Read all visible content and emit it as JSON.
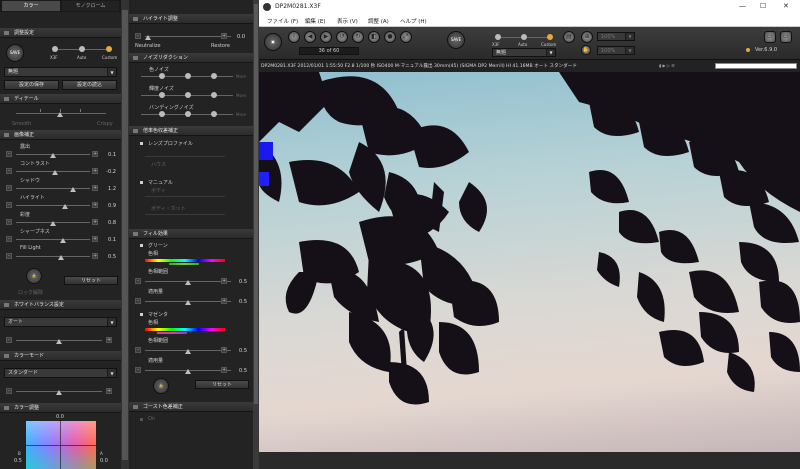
{
  "left_panel": {
    "tabs": [
      "カラー",
      "モノクローム"
    ],
    "adjust_section": {
      "title": "調整設定",
      "mode_labels": [
        "X3F",
        "Auto",
        "Custom"
      ],
      "preset_value": "無題",
      "save_button": "設定の保存",
      "load_button": "設定の読込"
    },
    "detail_section": {
      "title": "ディテール",
      "left_label": "Smooth",
      "right_label": "Crispy"
    },
    "image_section": {
      "title": "画像補正",
      "rows": [
        {
          "label": "露出",
          "value": "0.1"
        },
        {
          "label": "コントラスト",
          "value": "-0.2"
        },
        {
          "label": "シャドウ",
          "value": "1.2"
        },
        {
          "label": "ハイライト",
          "value": "0.9"
        },
        {
          "label": "彩度",
          "value": "0.8"
        },
        {
          "label": "シャープネス",
          "value": "0.1"
        },
        {
          "label": "Fill Light",
          "value": "0.5"
        }
      ],
      "reset_button": "リセット",
      "lock_label": "ロック解除"
    },
    "wb_section": {
      "title": "ホワイトバランス設定",
      "value": "オート"
    },
    "color_mode_section": {
      "title": "カラーモード",
      "value": "スタンダード"
    },
    "color_adjust_section": {
      "title": "カラー調整",
      "top_value": "0.0",
      "left_value": "0.5",
      "right_label": "A",
      "right_value": "0.0",
      "left_label": "B"
    }
  },
  "middle_panel": {
    "highlight_section": {
      "title": "ハイライト調整",
      "value": "0.0",
      "left_label": "Neutralize",
      "right_label": "Restore"
    },
    "noise_section": {
      "title": "ノイズリダクション",
      "rows": [
        "色ノイズ",
        "輝度ノイズ",
        "バンディングノイズ"
      ],
      "end_label": "More"
    },
    "lens_section": {
      "title": "倍率色収差補正",
      "profile_check": "レンズプロファイル",
      "manual_check": "マニュアル",
      "dim_labels": [
        "ハウス",
        "ボディ",
        "ボディ・カット"
      ]
    },
    "fill_section": {
      "title": "フィル効果",
      "blocks": [
        {
          "check": "グリーン",
          "sub": "色相",
          "range_label": "色相範囲",
          "amount_label": "適用量",
          "values": [
            "0.5",
            "0.5"
          ]
        },
        {
          "check": "マゼンタ",
          "sub": "色相",
          "range_label": "色相範囲",
          "amount_label": "適用量",
          "values": [
            "0.5",
            "0.5"
          ]
        }
      ],
      "reset_button": "リセット"
    },
    "ghost_section": {
      "title": "ゴースト色差補正",
      "check": "On"
    }
  },
  "window": {
    "title": "DP2M0281.X3F",
    "menu": [
      "ファイル (F)",
      "編集 (E)",
      "表示 (V)",
      "調整 (A)",
      "ヘルプ (H)"
    ],
    "controls": [
      "—",
      "☐",
      "✕"
    ]
  },
  "toolbar": {
    "counter": "36 of 60",
    "mode_labels": [
      "X3F",
      "Auto",
      "Custom"
    ],
    "preset_value": "無題",
    "zoom_values": [
      "100%",
      "100%"
    ],
    "version": "Ver.6.9.0",
    "save_label": "SAVE"
  },
  "info_bar": {
    "text": "DP2M0281.X3F 2012/01/01 1:55:50 F2.8 1/100 秒 ISO400 M-マニュアル露出 30mm(45) (SIGMA DP2 Merrill) HI 41.16MB オート スタンダード"
  },
  "colors": {
    "accent": "#e8a840",
    "panel": "#262626",
    "title_bar": "#ffffff"
  }
}
